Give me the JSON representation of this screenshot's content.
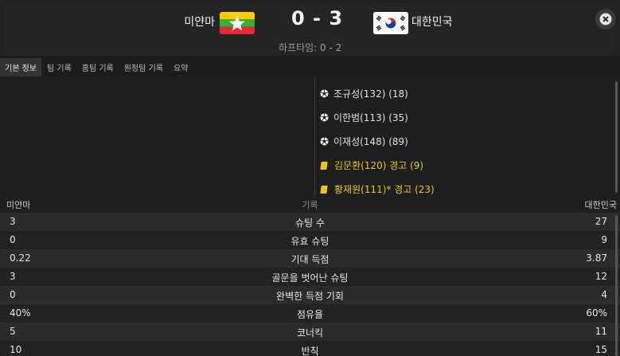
{
  "match": {
    "home_team": "미얀마",
    "away_team": "대한민국",
    "score": "0 - 3",
    "halftime": "하프타임: 0 - 2"
  },
  "tabs": [
    {
      "label": "기본 정보",
      "active": true
    },
    {
      "label": "팀 기록",
      "active": false
    },
    {
      "label": "홈팀 기록",
      "active": false
    },
    {
      "label": "원정팀 기록",
      "active": false
    },
    {
      "label": "요약",
      "active": false
    }
  ],
  "events": [
    {
      "type": "goal",
      "icon": "soccer-ball-icon",
      "text": "조규성(132) (18)"
    },
    {
      "type": "goal",
      "icon": "soccer-ball-icon",
      "text": "이한범(113) (35)"
    },
    {
      "type": "goal",
      "icon": "soccer-ball-icon",
      "text": "이재성(148) (89)"
    },
    {
      "type": "yellow",
      "icon": "yellow-card-icon",
      "text": "김문환(120) 경고 (9)"
    },
    {
      "type": "yellow",
      "icon": "yellow-card-icon",
      "text": "황재원(111)* 경고 (23)"
    }
  ],
  "stats_header": {
    "home": "미얀마",
    "label": "기록",
    "away": "대한민국"
  },
  "stats": [
    {
      "home": "3",
      "label": "슈팅 수",
      "away": "27"
    },
    {
      "home": "0",
      "label": "유효 슈팅",
      "away": "9"
    },
    {
      "home": "0.22",
      "label": "기대 득점",
      "away": "3.87"
    },
    {
      "home": "3",
      "label": "골문을 벗어난 슈팅",
      "away": "12"
    },
    {
      "home": "0",
      "label": "완벽한 득점 기회",
      "away": "4"
    },
    {
      "home": "40%",
      "label": "점유율",
      "away": "60%"
    },
    {
      "home": "5",
      "label": "코너킥",
      "away": "11"
    },
    {
      "home": "10",
      "label": "반칙",
      "away": "15"
    }
  ],
  "colors": {
    "yellow_card": "#f0c419",
    "myanmar_yellow": "#fecb00",
    "myanmar_green": "#34b233",
    "myanmar_red": "#ea2839",
    "korea_red": "#cd2e3a",
    "korea_blue": "#0047a0"
  }
}
